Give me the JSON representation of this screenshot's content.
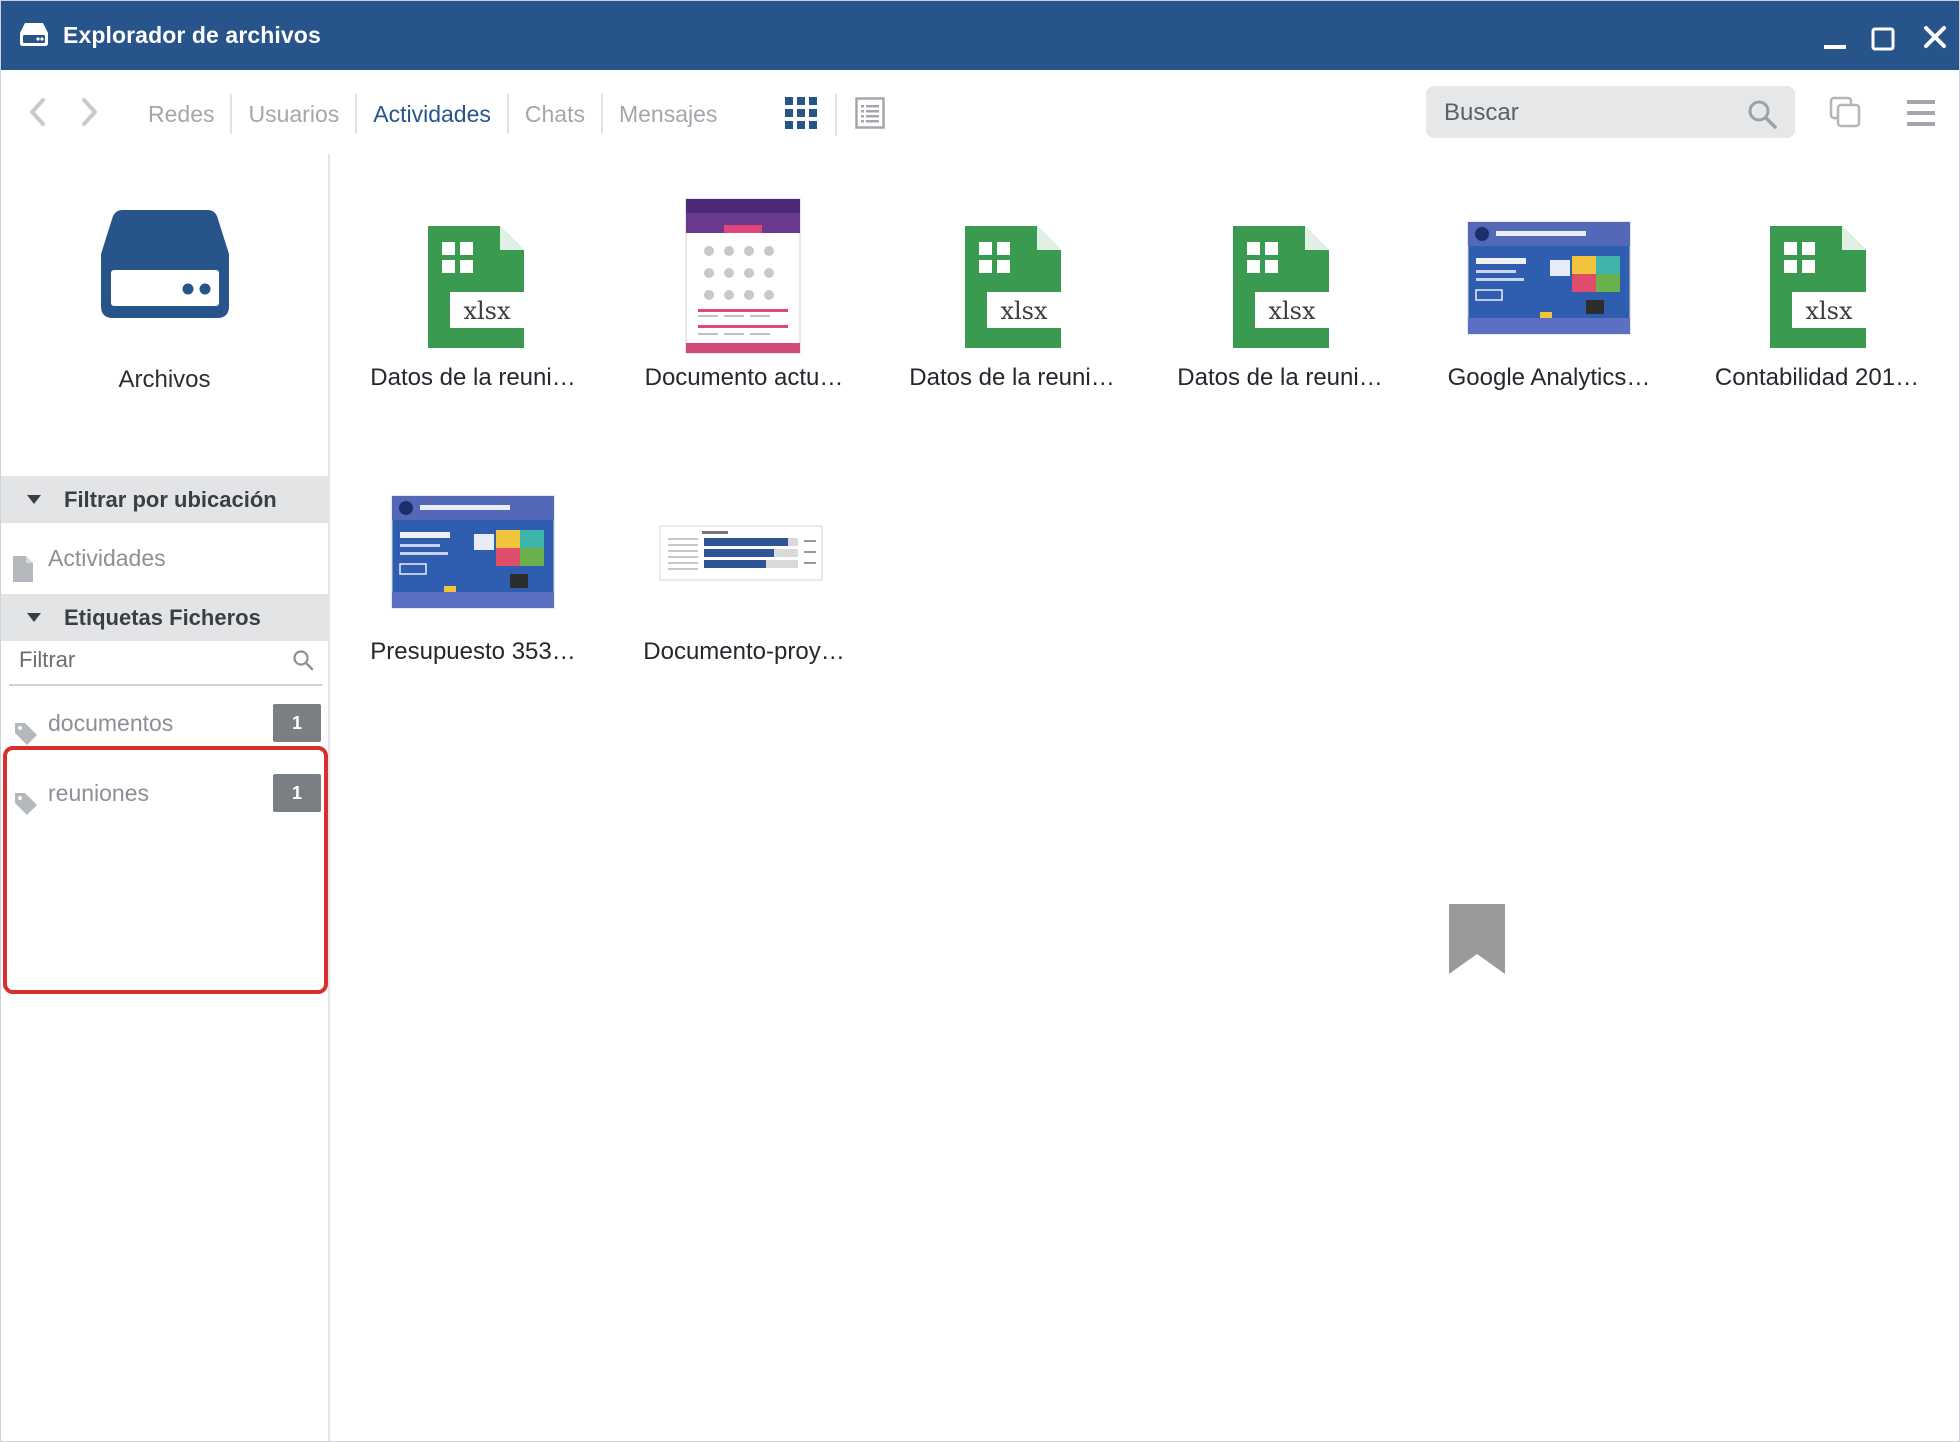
{
  "window": {
    "title": "Explorador de archivos",
    "accent_color": "#27548a",
    "icons": [
      "drive-icon",
      "minimize-icon",
      "maximize-icon",
      "close-icon"
    ]
  },
  "toolbar": {
    "tabs": [
      {
        "label": "Redes",
        "active": false
      },
      {
        "label": "Usuarios",
        "active": false
      },
      {
        "label": "Actividades",
        "active": true
      },
      {
        "label": "Chats",
        "active": false
      },
      {
        "label": "Mensajes",
        "active": false
      }
    ],
    "search_placeholder": "Buscar",
    "icons": [
      "back-arrow-icon",
      "forward-arrow-icon",
      "grid-view-icon",
      "list-view-icon",
      "search-icon",
      "windows-icon",
      "menu-icon"
    ]
  },
  "sidebar": {
    "root_label": "Archivos",
    "location_section": {
      "title": "Filtrar por ubicación",
      "items": [
        {
          "label": "Actividades",
          "icon": "document-icon"
        }
      ]
    },
    "tags_section": {
      "title": "Etiquetas Ficheros",
      "filter_placeholder": "Filtrar",
      "items": [
        {
          "label": "documentos",
          "count": "1",
          "icon": "tag-icon"
        },
        {
          "label": "reuniones",
          "count": "1",
          "icon": "tag-icon"
        }
      ]
    },
    "highlight_color": "#d6302c"
  },
  "files": [
    {
      "name": "Datos de la reuni…",
      "type": "xlsx",
      "icon_label": "xlsx"
    },
    {
      "name": "Documento actu…",
      "type": "image-poster"
    },
    {
      "name": "Datos de la reuni…",
      "type": "xlsx",
      "icon_label": "xlsx"
    },
    {
      "name": "Datos de la reuni…",
      "type": "xlsx",
      "icon_label": "xlsx"
    },
    {
      "name": "Google Analytics…",
      "type": "image-infographic"
    },
    {
      "name": "Contabilidad 201…",
      "type": "xlsx",
      "icon_label": "xlsx"
    },
    {
      "name": "Presupuesto 353…",
      "type": "image-infographic"
    },
    {
      "name": "Documento-proy…",
      "type": "image-chart"
    }
  ],
  "colors": {
    "xlsx_green": "#3a9a4f",
    "badge_gray": "#7b7e82",
    "bookmark_gray": "#9a9a9a"
  }
}
